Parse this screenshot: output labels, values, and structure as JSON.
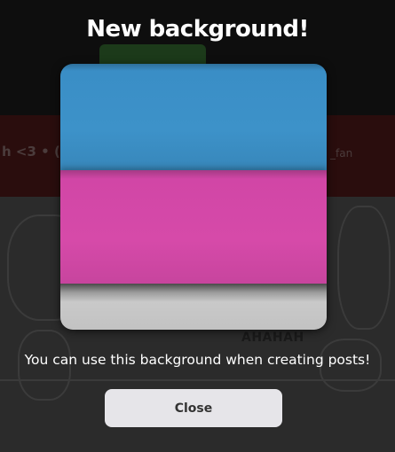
{
  "modal": {
    "title": "New background!",
    "message": "You can use this background when creating posts!",
    "close_label": "Close"
  },
  "background_preview": {
    "stripe_colors": [
      "#3d92c9",
      "#d64aa9",
      "#c9c9c9"
    ]
  },
  "backdrop": {
    "bar_text": "h <3 • (",
    "bar_user": "_fan",
    "post_text": "AHAHAH"
  },
  "colors": {
    "overlay": "#141414",
    "button_bg": "#e6e5e9",
    "title_text": "#ffffff"
  }
}
